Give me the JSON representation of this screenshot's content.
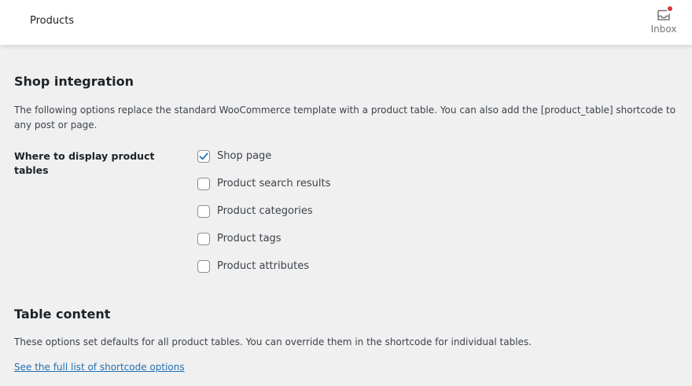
{
  "header": {
    "title": "Products",
    "inbox_label": "Inbox",
    "inbox_icon": "inbox-icon",
    "notification_color": "#d63638"
  },
  "shop_integration": {
    "title": "Shop integration",
    "description": "The following options replace the standard WooCommerce template with a product table. You can also add the [product_table] shortcode to any post or page.",
    "field_label": "Where to display product tables",
    "options": [
      {
        "label": "Shop page",
        "checked": true
      },
      {
        "label": "Product search results",
        "checked": false
      },
      {
        "label": "Product categories",
        "checked": false
      },
      {
        "label": "Product tags",
        "checked": false
      },
      {
        "label": "Product attributes",
        "checked": false
      }
    ]
  },
  "table_content": {
    "title": "Table content",
    "description": "These options set defaults for all product tables. You can override them in the shortcode for individual tables.",
    "link_text": "See the full list of shortcode options"
  },
  "colors": {
    "accent": "#2271b1",
    "background": "#f0f0f1"
  }
}
